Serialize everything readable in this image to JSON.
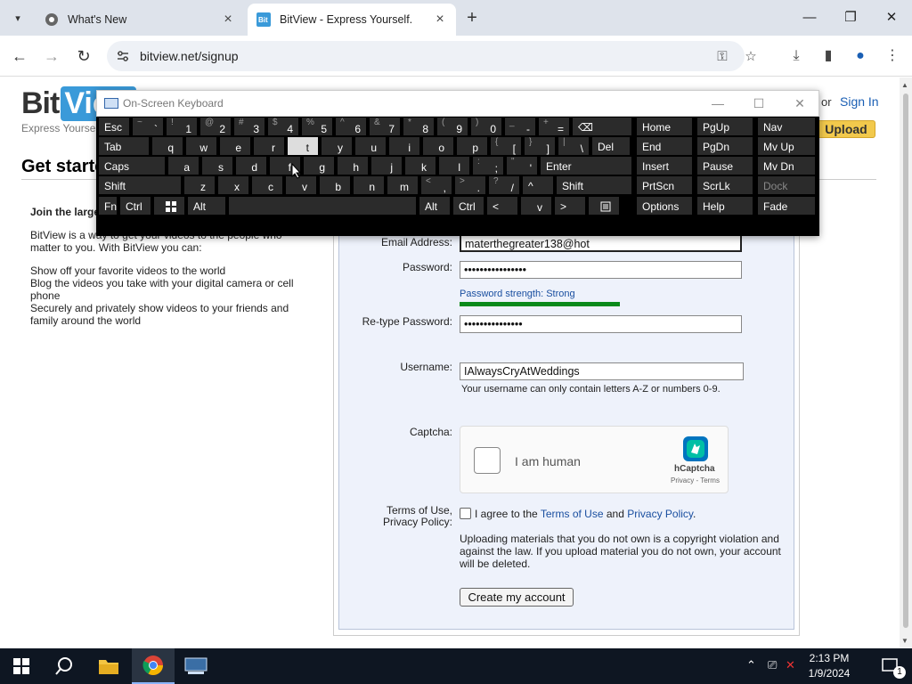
{
  "browser": {
    "tabs": [
      {
        "title": "What's New",
        "active": false
      },
      {
        "title": "BitView - Express Yourself.",
        "active": true
      }
    ],
    "url": "bitview.net/signup",
    "window_controls": {
      "minimize": "—",
      "maximize": "❐",
      "close": "✕"
    }
  },
  "site": {
    "logo_bit": "Bit",
    "logo_view": "View",
    "tagline": "Express Yourself.",
    "or": "or",
    "sign_in": "Sign In",
    "upload": "Upload",
    "heading": "Get started"
  },
  "intro": {
    "lead": "Join the largest",
    "paragraph": "BitView is a way to get your videos to the people who matter to you. With BitView you can:",
    "points": [
      "Show off your favorite videos to the world",
      "Blog the videos you take with your digital camera or cell phone",
      "Securely and privately show videos to your friends and family around the world"
    ]
  },
  "form": {
    "email_label": "Email Address:",
    "email_value": "materthegreater138@hot",
    "password_label": "Password:",
    "password_value": "••••••••••••••••",
    "password_strength": "Password strength: Strong",
    "retype_label": "Re-type Password:",
    "retype_value": "•••••••••••••••",
    "username_label": "Username:",
    "username_value": "IAlwaysCryAtWeddings",
    "username_hint": "Your username can only contain letters A-Z or numbers 0-9.",
    "captcha_label": "Captcha:",
    "captcha_text": "I am human",
    "captcha_brand": "hCaptcha",
    "captcha_privacy": "Privacy - Terms",
    "terms_label_1": "Terms of Use,",
    "terms_label_2": "Privacy Policy:",
    "terms_agree": "I agree to the ",
    "terms_of_use": "Terms of Use",
    "and": " and ",
    "privacy_policy": "Privacy Policy",
    "period": ".",
    "notice": "Uploading materials that you do not own is a copyright violation and against the law. If you upload material you do not own, your account will be deleted.",
    "create_button": "Create my account"
  },
  "osk": {
    "title": "On-Screen Keyboard",
    "row1": [
      {
        "main": "Esc"
      },
      {
        "top": "~",
        "bot": "`"
      },
      {
        "top": "!",
        "bot": "1"
      },
      {
        "top": "@",
        "bot": "2"
      },
      {
        "top": "#",
        "bot": "3"
      },
      {
        "top": "$",
        "bot": "4"
      },
      {
        "top": "%",
        "bot": "5"
      },
      {
        "top": "^",
        "bot": "6"
      },
      {
        "top": "&",
        "bot": "7"
      },
      {
        "top": "*",
        "bot": "8"
      },
      {
        "top": "(",
        "bot": "9"
      },
      {
        "top": ")",
        "bot": "0"
      },
      {
        "top": "_",
        "bot": "-"
      },
      {
        "top": "+",
        "bot": "="
      },
      {
        "main": "⌫"
      }
    ],
    "row2": [
      {
        "main": "Tab"
      },
      {
        "main": "q"
      },
      {
        "main": "w"
      },
      {
        "main": "e"
      },
      {
        "main": "r"
      },
      {
        "main": "t"
      },
      {
        "main": "y"
      },
      {
        "main": "u"
      },
      {
        "main": "i"
      },
      {
        "main": "o"
      },
      {
        "main": "p"
      },
      {
        "top": "{",
        "bot": "["
      },
      {
        "top": "}",
        "bot": "]"
      },
      {
        "top": "|",
        "bot": "\\"
      },
      {
        "main": "Del"
      }
    ],
    "row3": [
      {
        "main": "Caps"
      },
      {
        "main": "a"
      },
      {
        "main": "s"
      },
      {
        "main": "d"
      },
      {
        "main": "f"
      },
      {
        "main": "g"
      },
      {
        "main": "h"
      },
      {
        "main": "j"
      },
      {
        "main": "k"
      },
      {
        "main": "l"
      },
      {
        "top": ":",
        "bot": ";"
      },
      {
        "top": "\"",
        "bot": "'"
      },
      {
        "main": "Enter"
      }
    ],
    "row4": [
      {
        "main": "Shift"
      },
      {
        "main": "z"
      },
      {
        "main": "x"
      },
      {
        "main": "c"
      },
      {
        "main": "v"
      },
      {
        "main": "b"
      },
      {
        "main": "n"
      },
      {
        "main": "m"
      },
      {
        "top": "<",
        "bot": ","
      },
      {
        "top": ">",
        "bot": "."
      },
      {
        "top": "?",
        "bot": "/"
      },
      {
        "main": "^"
      },
      {
        "main": "Shift"
      }
    ],
    "row5": [
      {
        "main": "Fn"
      },
      {
        "main": "Ctrl"
      },
      {
        "main": "win-icon"
      },
      {
        "main": "Alt"
      },
      {
        "main": ""
      },
      {
        "main": "Alt"
      },
      {
        "main": "Ctrl"
      },
      {
        "main": "<"
      },
      {
        "main": "v"
      },
      {
        "main": ">"
      },
      {
        "main": "menu-icon"
      }
    ],
    "nav": [
      [
        "Home",
        "PgUp",
        "Nav"
      ],
      [
        "End",
        "PgDn",
        "Mv Up"
      ],
      [
        "Insert",
        "Pause",
        "Mv Dn"
      ],
      [
        "PrtScn",
        "ScrLk",
        "Dock"
      ],
      [
        "Options",
        "Help",
        "Fade"
      ]
    ]
  },
  "taskbar": {
    "time": "2:13 PM",
    "date": "1/9/2024",
    "notifications": "1"
  },
  "colors": {
    "accent": "#1a4fa0",
    "strength_bar": "#0a8a1a",
    "upload_button": "#f2c94c",
    "osk_key": "#2b2b2b",
    "taskbar": "#0e1622"
  }
}
